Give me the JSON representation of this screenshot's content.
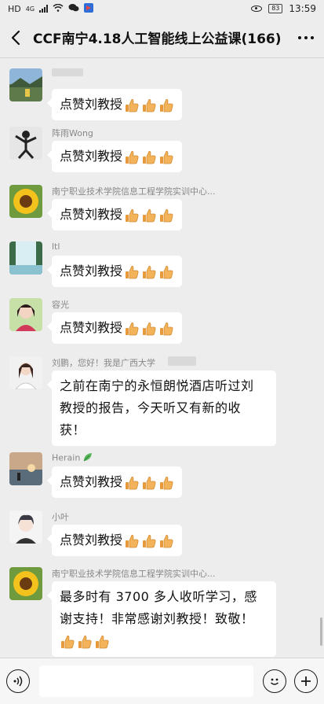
{
  "status_bar": {
    "network": "HD",
    "network_gen": "4G",
    "battery": "83",
    "time": "13:59"
  },
  "header": {
    "title": "CCF南宁4.18人工智能线上公益课(166)"
  },
  "messages": [
    {
      "sender": "",
      "text": "点赞刘教授",
      "thumbs": 3,
      "avatar": "landscape-avatar-icon"
    },
    {
      "sender": "阵雨Wong",
      "text": "点赞刘教授",
      "thumbs": 3,
      "avatar": "dancer-avatar-icon"
    },
    {
      "sender": "南宁职业技术学院信息工程学院实训中心...",
      "text": "点赞刘教授",
      "thumbs": 3,
      "avatar": "sunflower-avatar-icon"
    },
    {
      "sender": "ltl",
      "text": "点赞刘教授",
      "thumbs": 3,
      "avatar": "waterfall-avatar-icon"
    },
    {
      "sender": "容光",
      "text": "点赞刘教授",
      "thumbs": 3,
      "avatar": "portrait-avatar-icon"
    },
    {
      "sender": "刘鹏，您好！我是广西大学",
      "lines": [
        "之前在南宁的永恒朗悦酒店听过刘",
        "教授的报告，今天听又有新的收",
        "获！"
      ],
      "avatar": "woman-avatar-icon"
    },
    {
      "sender": "Herain",
      "text": "点赞刘教授",
      "thumbs": 3,
      "avatar": "sunset-avatar-icon"
    },
    {
      "sender": "小叶",
      "text": "点赞刘教授",
      "thumbs": 3,
      "avatar": "anime-avatar-icon"
    },
    {
      "sender": "南宁职业技术学院信息工程学院实训中心...",
      "lines": [
        "最多时有 3700 多人收听学习，感",
        "谢支持！非常感谢刘教授！致敬！"
      ],
      "thumbs": 3,
      "avatar": "sunflower-avatar-icon"
    }
  ],
  "colors": {
    "background": "#ededed",
    "bubble": "#ffffff",
    "thumb": "#f2b35b"
  }
}
